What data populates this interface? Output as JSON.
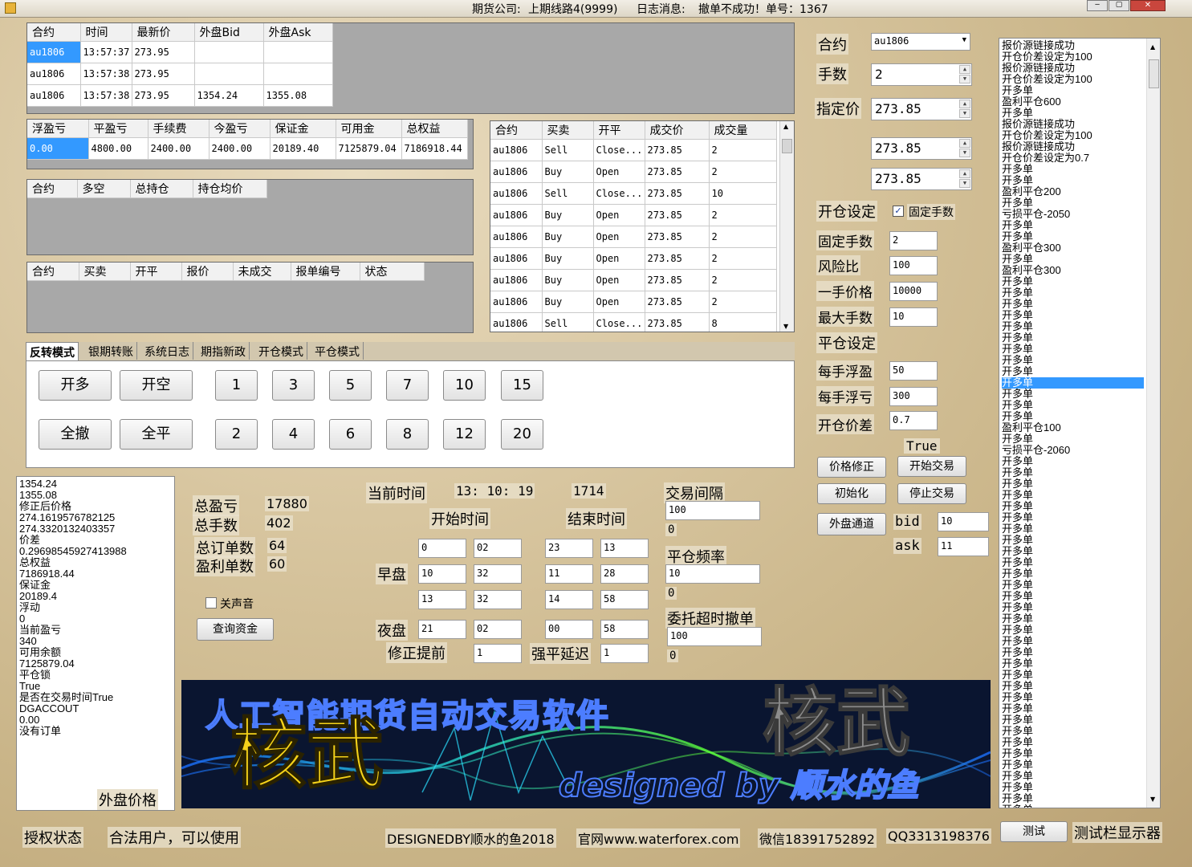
{
  "titlebar": {
    "company_label": "期货公司:",
    "company_value": "上期线路4(9999)",
    "log_label": "日志消息:",
    "log_value": "撤单不成功！单号：1367"
  },
  "ticks": {
    "headers": [
      "合约",
      "时间",
      "最新价",
      "外盘Bid",
      "外盘Ask"
    ],
    "rows": [
      [
        "au1806",
        "13:57:37",
        "273.95",
        "",
        ""
      ],
      [
        "au1806",
        "13:57:38",
        "273.95",
        "",
        ""
      ],
      [
        "au1806",
        "13:57:38",
        "273.95",
        "1354.24",
        "1355.08"
      ]
    ]
  },
  "account": {
    "headers": [
      "浮盈亏",
      "平盈亏",
      "手续费",
      "今盈亏",
      "保证金",
      "可用金",
      "总权益"
    ],
    "row": [
      "0.00",
      "4800.00",
      "2400.00",
      "2400.00",
      "20189.40",
      "7125879.04",
      "7186918.44"
    ]
  },
  "positions": {
    "headers": [
      "合约",
      "多空",
      "总持仓",
      "持仓均价"
    ]
  },
  "orders": {
    "headers": [
      "合约",
      "买卖",
      "开平",
      "报价",
      "未成交",
      "报单编号",
      "状态"
    ]
  },
  "trades": {
    "headers": [
      "合约",
      "买卖",
      "开平",
      "成交价",
      "成交量"
    ],
    "rows": [
      [
        "au1806",
        "Sell",
        "Close...",
        "273.85",
        "2"
      ],
      [
        "au1806",
        "Buy",
        "Open",
        "273.85",
        "2"
      ],
      [
        "au1806",
        "Sell",
        "Close...",
        "273.85",
        "10"
      ],
      [
        "au1806",
        "Buy",
        "Open",
        "273.85",
        "2"
      ],
      [
        "au1806",
        "Buy",
        "Open",
        "273.85",
        "2"
      ],
      [
        "au1806",
        "Buy",
        "Open",
        "273.85",
        "2"
      ],
      [
        "au1806",
        "Buy",
        "Open",
        "273.85",
        "2"
      ],
      [
        "au1806",
        "Buy",
        "Open",
        "273.85",
        "2"
      ],
      [
        "au1806",
        "Sell",
        "Close...",
        "273.85",
        "8"
      ]
    ]
  },
  "tabs": [
    "反转模式",
    "银期转账",
    "系统日志",
    "期指新政",
    "开仓模式",
    "平仓模式"
  ],
  "mode_buttons": {
    "open_long": "开多",
    "open_short": "开空",
    "cancel_all": "全撤",
    "close_all": "全平",
    "qty_row1": [
      "1",
      "3",
      "5",
      "7",
      "10",
      "15"
    ],
    "qty_row2": [
      "2",
      "4",
      "6",
      "8",
      "12",
      "20"
    ]
  },
  "info_lines": [
    "1354.24",
    "1355.08",
    "修正后价格",
    "274.1619576782125",
    "274.3320132403357",
    "价差",
    "0.29698545927413988",
    "总权益",
    "7186918.44",
    "保证金",
    "20189.4",
    "浮动",
    "0",
    "当前盈亏",
    "340",
    "可用余额",
    "7125879.04",
    "平仓锁",
    "True",
    "是否在交易时间True",
    "DGACCOUT",
    "0.00",
    "没有订单"
  ],
  "info_footer": "外盘价格",
  "stats": {
    "total_pnl_label": "总盈亏",
    "total_pnl": "17880",
    "total_qty_label": "总手数",
    "total_qty": "402",
    "total_orders_label": "总订单数",
    "total_orders": "64",
    "profit_orders_label": "盈利单数",
    "profit_orders": "60",
    "mute_label": "关声音",
    "query_btn": "查询资金"
  },
  "schedule": {
    "now_label": "当前时间",
    "now_value": "13: 10: 19",
    "counter": "1714",
    "start_label": "开始时间",
    "end_label": "结束时间",
    "morning_label": "早盘",
    "night_label": "夜盘",
    "fix_label": "修正提前",
    "force_label": "强平延迟",
    "rows": [
      [
        "0",
        "02",
        "23",
        "13"
      ],
      [
        "10",
        "32",
        "11",
        "28"
      ],
      [
        "13",
        "32",
        "14",
        "58"
      ],
      [
        "21",
        "02",
        "00",
        "58"
      ]
    ],
    "fix_value": "1",
    "force_value": "1",
    "interval_label": "交易间隔",
    "interval_value": "100",
    "interval_zero": "0",
    "close_freq_label": "平仓频率",
    "close_freq_value": "10",
    "close_freq_zero": "0",
    "timeout_label": "委托超时撤单",
    "timeout_value": "100",
    "timeout_zero": "0"
  },
  "right": {
    "contract_label": "合约",
    "contract_value": "au1806",
    "lots_label": "手数",
    "lots_value": "2",
    "price_label": "指定价",
    "price_value": "273.85",
    "price2": "273.85",
    "price3": "273.85",
    "open_setting_label": "开仓设定",
    "fixed_lots_check": "固定手数",
    "fixed_lots_label": "固定手数",
    "fixed_lots_value": "2",
    "risk_label": "风险比",
    "risk_value": "100",
    "one_lot_label": "一手价格",
    "one_lot_value": "10000",
    "max_lots_label": "最大手数",
    "max_lots_value": "10",
    "close_setting_label": "平仓设定",
    "per_profit_label": "每手浮盈",
    "per_profit_value": "50",
    "per_loss_label": "每手浮亏",
    "per_loss_value": "300",
    "spread_label": "开仓价差",
    "spread_value": "0.7",
    "true_label": "True",
    "btn_fix": "价格修正",
    "btn_start": "开始交易",
    "btn_init": "初始化",
    "btn_stop": "停止交易",
    "btn_ext": "外盘通道",
    "bid_label": "bid",
    "bid_value": "10",
    "ask_label": "ask",
    "ask_value": "11"
  },
  "log": [
    "报价源链接成功",
    "开仓价差设定为100",
    "报价源链接成功",
    "开仓价差设定为100",
    "开多单",
    "盈利平仓600",
    "开多单",
    "报价源链接成功",
    "开仓价差设定为100",
    "报价源链接成功",
    "开仓价差设定为0.7",
    "开多单",
    "开多单",
    "盈利平仓200",
    "开多单",
    "亏损平仓-2050",
    "开多单",
    "开多单",
    "盈利平仓300",
    "开多单",
    "盈利平仓300",
    "开多单",
    "开多单",
    "开多单",
    "开多单",
    "开多单",
    "开多单",
    "开多单",
    "开多单",
    "开多单",
    "开多单",
    "开多单",
    "开多单",
    "开多单",
    "盈利平仓100",
    "开多单",
    "亏损平仓-2060",
    "开多单",
    "开多单",
    "开多单",
    "开多单",
    "开多单",
    "开多单",
    "开多单",
    "开多单",
    "开多单",
    "开多单",
    "开多单",
    "开多单",
    "开多单",
    "开多单",
    "开多单",
    "开多单",
    "开多单",
    "开多单",
    "开多单",
    "开多单",
    "开多单",
    "开多单",
    "开多单",
    "开多单",
    "开多单",
    "开多单",
    "开多单",
    "开多单",
    "开多单",
    "开多单",
    "开多单",
    "开多单"
  ],
  "log_selected_index": 30,
  "banner": {
    "line1": "人工智能期货自动交易软件",
    "big": "核武",
    "big2": "核武",
    "sub": "designed by 顺水的鱼"
  },
  "status": {
    "auth_label": "授权状态",
    "auth_value": "合法用户，可以使用",
    "designed": "DESIGNEDBY顺水的鱼2018",
    "site": "官网www.waterforex.com",
    "wechat": "微信18391752892",
    "qq": "QQ3313198376",
    "test_btn": "测试",
    "test_label": "测试栏显示器"
  },
  "colors": {
    "selection": "#3399ff",
    "banner_bg": "#0a1530",
    "banner_yellow": "#f5d21a"
  }
}
